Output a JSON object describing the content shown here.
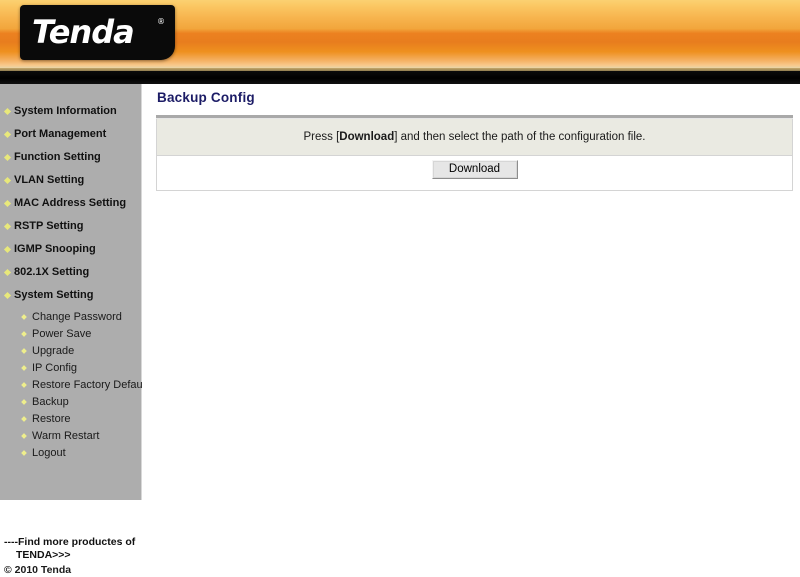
{
  "header": {
    "logo_text": "Tenda",
    "logo_trademark": "®"
  },
  "sidebar": {
    "main_items": [
      {
        "label": "System Information"
      },
      {
        "label": "Port Management"
      },
      {
        "label": "Function Setting"
      },
      {
        "label": "VLAN Setting"
      },
      {
        "label": "MAC Address Setting"
      },
      {
        "label": "RSTP Setting"
      },
      {
        "label": "IGMP Snooping"
      },
      {
        "label": "802.1X Setting"
      },
      {
        "label": "System Setting"
      }
    ],
    "submenu_items": [
      {
        "label": "Change Password"
      },
      {
        "label": "Power Save"
      },
      {
        "label": "Upgrade"
      },
      {
        "label": "IP Config"
      },
      {
        "label": "Restore Factory Default"
      },
      {
        "label": "Backup"
      },
      {
        "label": "Restore"
      },
      {
        "label": "Warm Restart"
      },
      {
        "label": "Logout"
      }
    ],
    "footer": {
      "find_more_line1": "----Find more productes of",
      "find_more_line2": "TENDA>>>",
      "copyright": "© 2010 Tenda"
    }
  },
  "main": {
    "page_title": "Backup Config",
    "instruction": {
      "prefix": "Press [",
      "bold": "Download",
      "suffix": "] and then select the path of the configuration file."
    },
    "download_button_label": "Download"
  },
  "colors": {
    "accent_orange": "#ec8120",
    "title_blue": "#1c1c66",
    "sidebar_gray": "#adadad",
    "info_row_bg": "#eaeae2",
    "bullet_yellow": "#e8e87a"
  }
}
